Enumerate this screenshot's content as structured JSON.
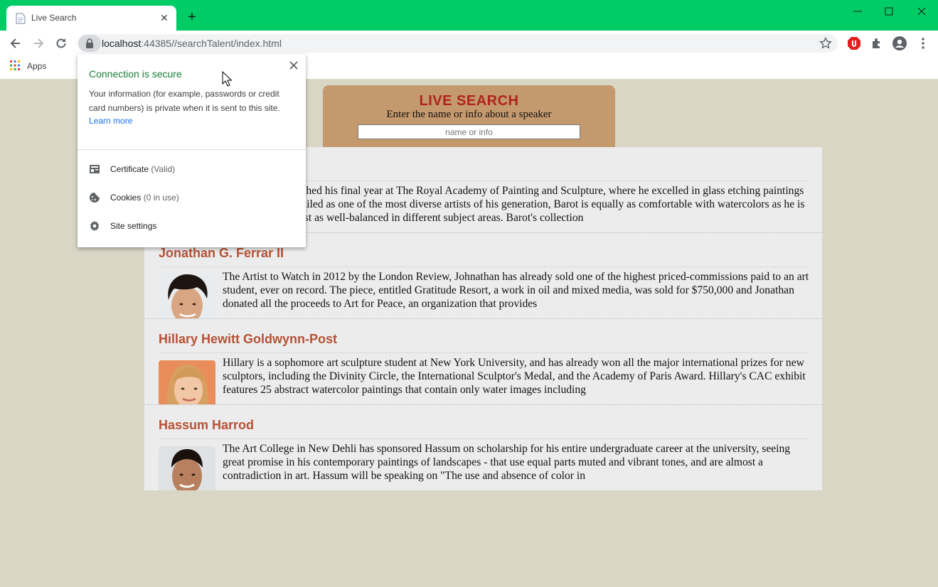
{
  "browser": {
    "tab_title": "Live Search",
    "url_host": "localhost",
    "url_rest": ":44385//searchTalent/index.html",
    "bookmarks_apps": "Apps"
  },
  "site_info": {
    "title": "Connection is secure",
    "body": "Your information (for example, passwords or credit card numbers) is private when it is sent to this site.",
    "learn_more": "Learn more",
    "items": [
      {
        "label": "Certificate",
        "sub": "(Valid)",
        "icon": "certificate-icon"
      },
      {
        "label": "Cookies",
        "sub": "(0 in use)",
        "icon": "cookie-icon"
      },
      {
        "label": "Site settings",
        "sub": "",
        "icon": "gear-icon"
      }
    ]
  },
  "search": {
    "title": "LIVE SEARCH",
    "subtitle": "Enter the name or info about a speaker",
    "placeholder": "name or info"
  },
  "speakers": [
    {
      "name": "",
      "bio": "Barot has just finished his final year at The Royal Academy of Painting and Sculpture, where he excelled in glass etching paintings and portraiture. Hailed as one of the most diverse artists of his generation, Barot is equally as comfortable with watercolors as he is with oils, and is just as well-balanced in different subject areas. Barot's collection"
    },
    {
      "name": "Jonathan G. Ferrar II",
      "bio": "The Artist to Watch in 2012 by the London Review, Johnathan has already sold one of the highest priced-commissions paid to an art student, ever on record. The piece, entitled Gratitude Resort, a work in oil and mixed media, was sold for $750,000 and Jonathan donated all the proceeds to Art for Peace, an organization that provides"
    },
    {
      "name": "Hillary Hewitt Goldwynn-Post",
      "bio": "Hillary is a sophomore art sculpture student at New York University, and has already won all the major international prizes for new sculptors, including the Divinity Circle, the International Sculptor's Medal, and the Academy of Paris Award. Hillary's CAC exhibit features 25 abstract watercolor paintings that contain only water images including"
    },
    {
      "name": "Hassum Harrod",
      "bio": "The Art College in New Dehli has sponsored Hassum on scholarship for his entire undergraduate career at the university, seeing great promise in his contemporary paintings of landscapes - that use equal parts muted and vibrant tones, and are almost a contradiction in art. Hassum will be speaking on \"The use and absence of color in"
    }
  ],
  "colors": {
    "titlebar": "#00cc66",
    "page_bg": "#dad6c5",
    "search_box": "#c4996d",
    "search_title": "#b0231e",
    "speaker_name": "#b55235",
    "secure_text": "#188038",
    "link": "#1a73e8"
  }
}
